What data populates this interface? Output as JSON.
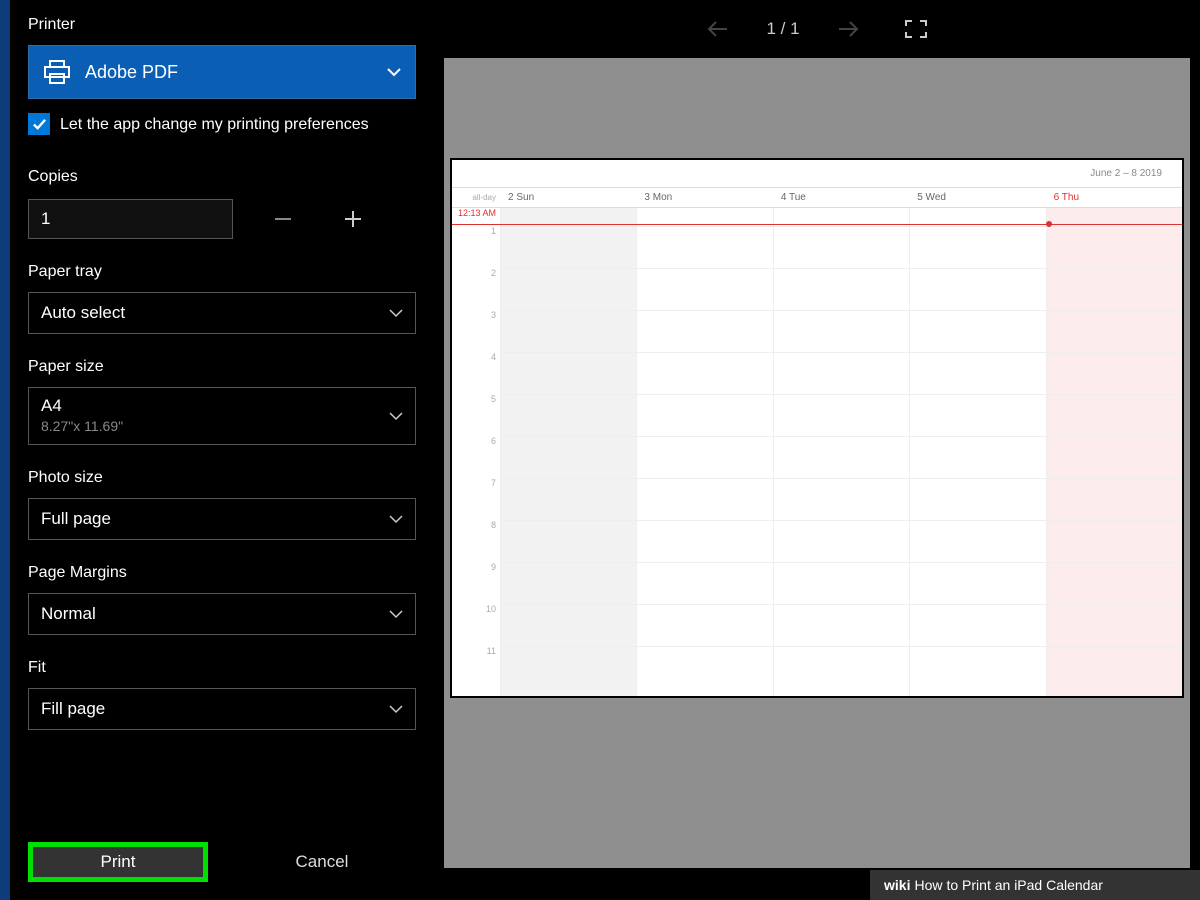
{
  "panel": {
    "printer_label": "Printer",
    "printer_selected": "Adobe PDF",
    "preferences_checkbox_label": "Let the app change my printing preferences",
    "copies_label": "Copies",
    "copies_value": "1",
    "paper_tray_label": "Paper tray",
    "paper_tray_value": "Auto select",
    "paper_size_label": "Paper size",
    "paper_size_value": "A4",
    "paper_size_sub": "8.27\"x 11.69\"",
    "photo_size_label": "Photo size",
    "photo_size_value": "Full page",
    "page_margins_label": "Page Margins",
    "page_margins_value": "Normal",
    "fit_label": "Fit",
    "fit_value": "Fill page",
    "print_button": "Print",
    "cancel_button": "Cancel"
  },
  "preview": {
    "page_indicator": "1 / 1"
  },
  "calendar": {
    "topbar": "June 2 – 8 2019",
    "allday": "all-day",
    "now_label": "12:13 AM",
    "days": [
      "2 Sun",
      "3 Mon",
      "4 Tue",
      "5 Wed",
      "6 Thu"
    ],
    "hours": [
      "1",
      "2",
      "3",
      "4",
      "5",
      "6",
      "7",
      "8",
      "9",
      "10",
      "11"
    ]
  },
  "footer": {
    "wiki": "wiki",
    "how": "How",
    "rest": " to Print an iPad Calendar"
  }
}
